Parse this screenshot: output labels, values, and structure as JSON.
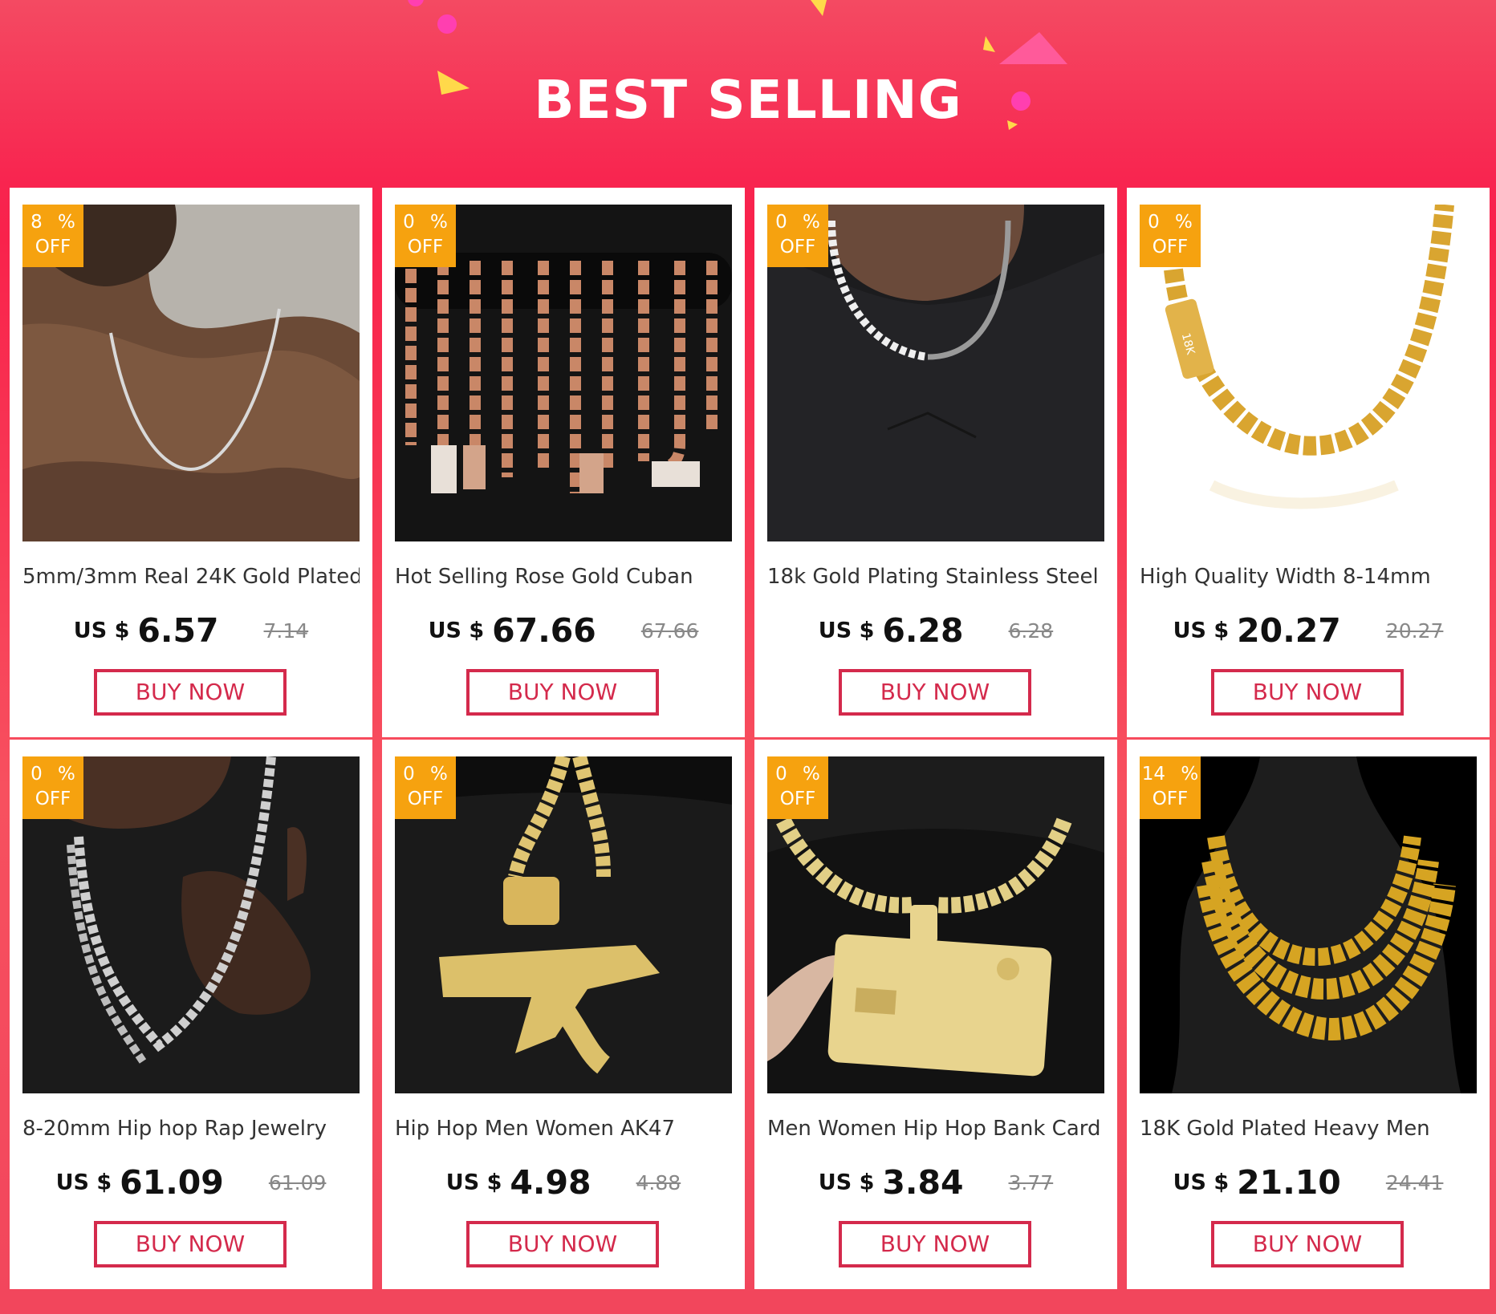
{
  "header": {
    "title": "BEST SELLING"
  },
  "colors": {
    "banner": "#f9224b",
    "badge": "#f6a20f",
    "button": "#d42a4c"
  },
  "products": [
    {
      "discount": "8 %",
      "off": "OFF",
      "name": "5mm/3mm Real 24K Gold Plated",
      "currency": "US $",
      "price": "6.57",
      "original_price": "7.14",
      "button": "BUY NOW",
      "image": "man-thin-silver-chain"
    },
    {
      "discount": "0 %",
      "off": "OFF",
      "name": "Hot Selling Rose Gold Cuban",
      "currency": "US $",
      "price": "67.66",
      "original_price": "67.66",
      "button": "BUY NOW",
      "image": "rose-gold-cuban-chains"
    },
    {
      "discount": "0 %",
      "off": "OFF",
      "name": "18k Gold Plating Stainless Steel",
      "currency": "US $",
      "price": "6.28",
      "original_price": "6.28",
      "button": "BUY NOW",
      "image": "pearl-chain-necklace"
    },
    {
      "discount": "0 %",
      "off": "OFF",
      "name": "High Quality Width 8-14mm",
      "currency": "US $",
      "price": "20.27",
      "original_price": "20.27",
      "button": "BUY NOW",
      "image": "gold-cuban-link-18k"
    },
    {
      "discount": "0 %",
      "off": "OFF",
      "name": "8-20mm Hip hop Rap Jewelry",
      "currency": "US $",
      "price": "61.09",
      "original_price": "61.09",
      "button": "BUY NOW",
      "image": "silver-double-chain"
    },
    {
      "discount": "0 %",
      "off": "OFF",
      "name": "Hip Hop Men Women AK47",
      "currency": "US $",
      "price": "4.98",
      "original_price": "4.88",
      "button": "BUY NOW",
      "image": "ak47-pendant"
    },
    {
      "discount": "0 %",
      "off": "OFF",
      "name": "Men Women Hip Hop Bank Card",
      "currency": "US $",
      "price": "3.84",
      "original_price": "3.77",
      "button": "BUY NOW",
      "image": "bank-card-pendant"
    },
    {
      "discount": "14 %",
      "off": "OFF",
      "name": "18K Gold Plated Heavy Men",
      "currency": "US $",
      "price": "21.10",
      "original_price": "24.41",
      "button": "BUY NOW",
      "image": "heavy-gold-chains"
    }
  ]
}
